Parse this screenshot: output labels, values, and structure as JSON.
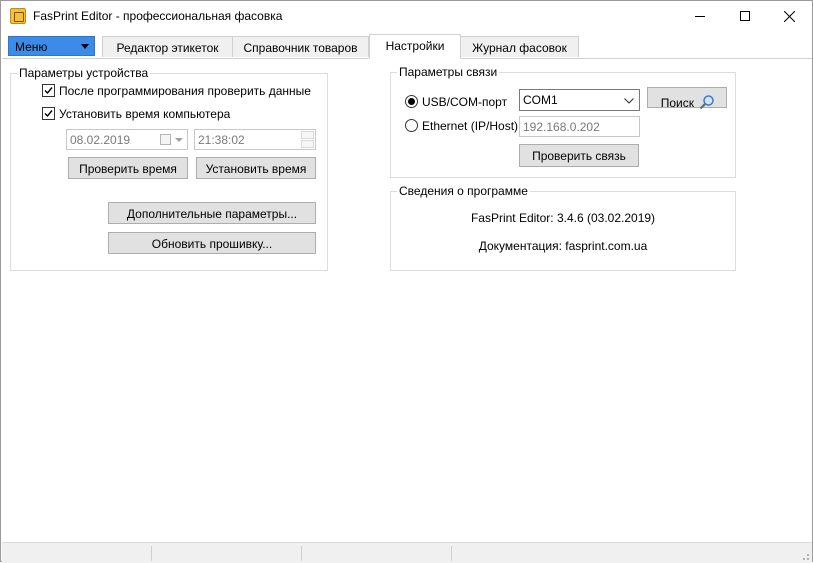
{
  "window": {
    "title": "FasPrint Editor - профессиональная фасовка",
    "icon": "fasprint-app-icon",
    "controls": [
      "minimize-icon",
      "maximize-icon",
      "close-icon"
    ]
  },
  "menu": {
    "label": "Меню"
  },
  "tabs": [
    {
      "label": "Редактор этикеток",
      "active": false
    },
    {
      "label": "Справочник товаров",
      "active": false
    },
    {
      "label": "Настройки",
      "active": true
    },
    {
      "label": "Журнал фасовок",
      "active": false
    }
  ],
  "device": {
    "title": "Параметры устройства",
    "verify_after_programming": {
      "label": "После программирования проверить данные",
      "checked": true
    },
    "set_computer_time": {
      "label": "Установить время компьютера",
      "checked": true
    },
    "date": "08.02.2019",
    "time": "21:38:02",
    "check_time_label": "Проверить время",
    "set_time_label": "Установить время",
    "extra_params_label": "Дополнительные параметры...",
    "update_firmware_label": "Обновить прошивку..."
  },
  "connection": {
    "title": "Параметры связи",
    "usb_label": "USB/COM-порт",
    "ethernet_label": "Ethernet (IP/Host)",
    "selected": "usb",
    "com_port": "COM1",
    "ip_host": "192.168.0.202",
    "search_label": "Поиск",
    "search_icon": "magnifier-icon",
    "check_connection_label": "Проверить связь"
  },
  "about": {
    "title": "Сведения о программе",
    "version": "FasPrint Editor: 3.4.6 (03.02.2019)",
    "docs": "Документация: fasprint.com.ua"
  }
}
